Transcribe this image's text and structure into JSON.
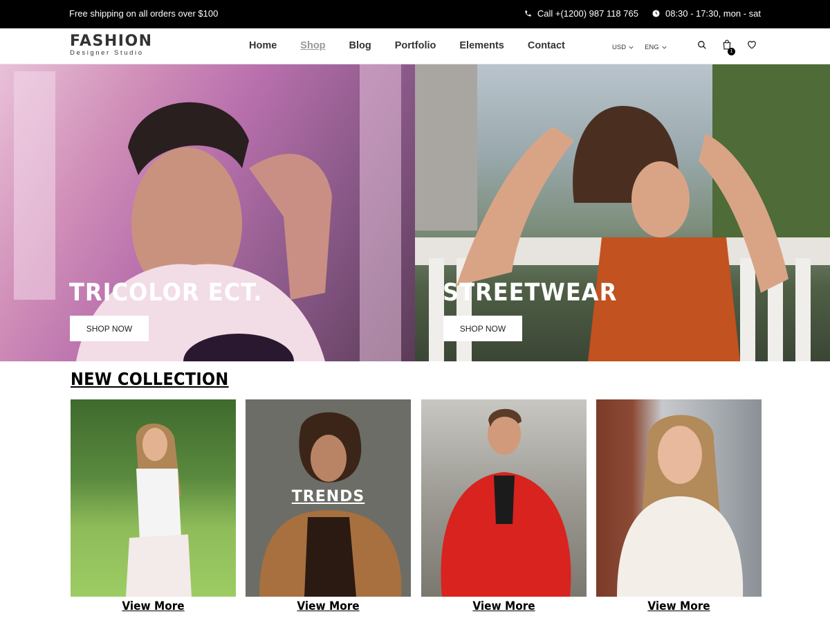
{
  "topbar": {
    "shipping": "Free shipping on all orders over $100",
    "phone": "Call +(1200) 987 118 765",
    "hours": "08:30 - 17:30, mon - sat"
  },
  "header": {
    "logo_name": "FASHION",
    "logo_tagline": "Designer Studio",
    "nav": [
      {
        "label": "Home",
        "active": false
      },
      {
        "label": "Shop",
        "active": true
      },
      {
        "label": "Blog",
        "active": false
      },
      {
        "label": "Portfolio",
        "active": false
      },
      {
        "label": "Elements",
        "active": false
      },
      {
        "label": "Contact",
        "active": false
      }
    ],
    "currency": "USD",
    "language": "ENG",
    "cart_count": "1"
  },
  "hero": [
    {
      "title": "TRICOLOR ECT.",
      "button": "SHOP NOW"
    },
    {
      "title": "STREETWEAR",
      "button": "SHOP NOW"
    }
  ],
  "collection": {
    "title": "NEW COLLECTION",
    "cards": [
      {
        "overlay": "",
        "link": "View More"
      },
      {
        "overlay": "TRENDS",
        "link": "View More"
      },
      {
        "overlay": "",
        "link": "View More"
      },
      {
        "overlay": "",
        "link": "View More"
      }
    ]
  },
  "colors": {
    "topbar_bg": "#000000",
    "text": "#222222",
    "active_nav": "#999999"
  }
}
